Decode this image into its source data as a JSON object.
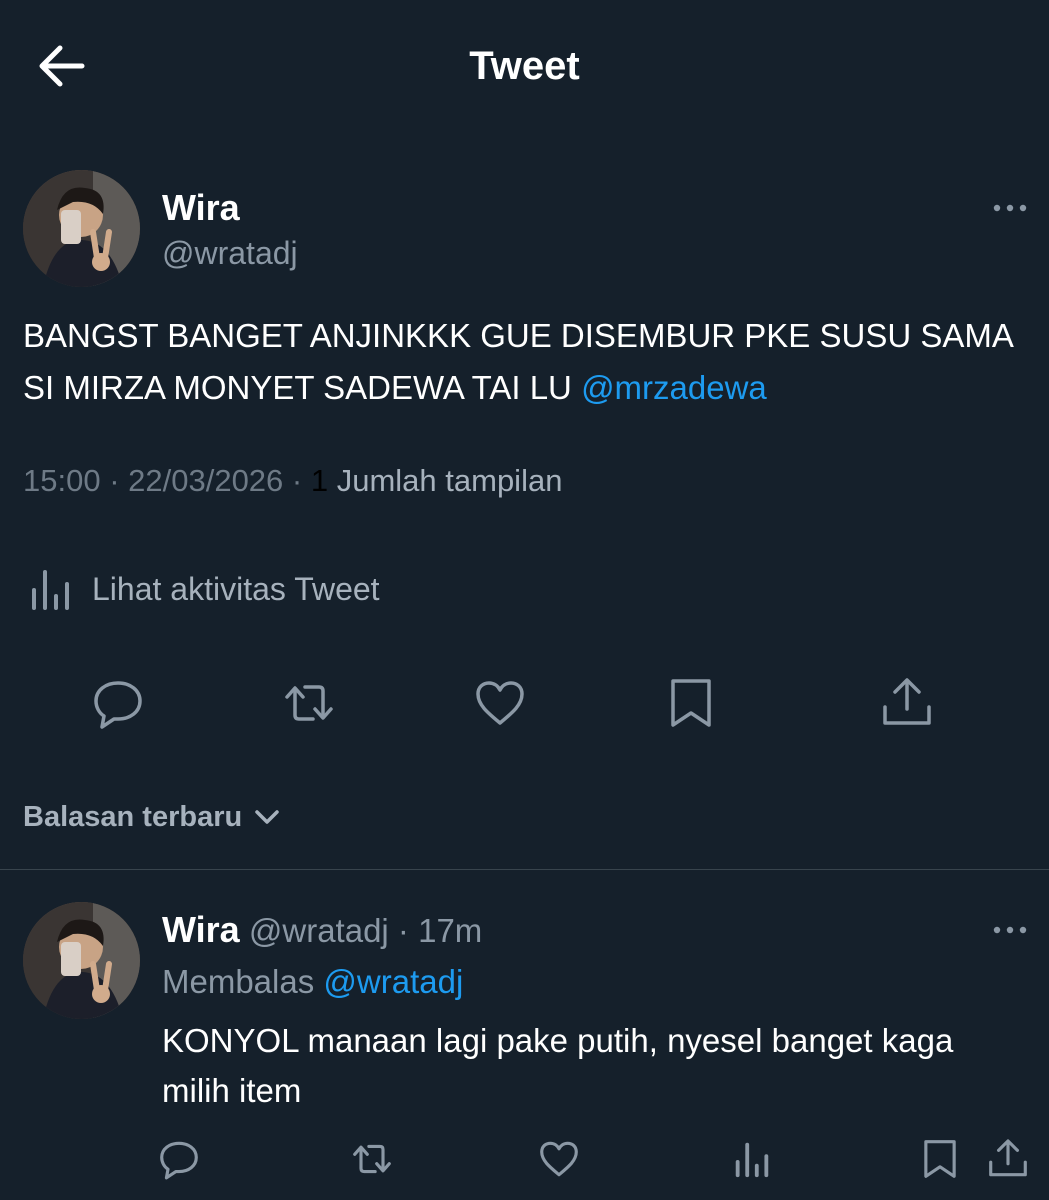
{
  "header": {
    "title": "Tweet"
  },
  "tweet": {
    "author_name": "Wira",
    "author_handle": "@wratadj",
    "text": "BANGST BANGET ANJINKKK GUE DISEMBUR PKE SUSU SAMA SI MIRZA MONYET SADEWA TAI LU ",
    "mention": "@mrzadewa",
    "time": "15:00",
    "date": "22/03/2026",
    "separator": " · ",
    "views_count": "1",
    "views_label": " Jumlah tampilan",
    "activity_label": "Lihat aktivitas Tweet"
  },
  "replies_sort": {
    "label": "Balasan terbaru"
  },
  "reply": {
    "author_name": "Wira",
    "author_handle": "@wratadj",
    "separator": " · ",
    "time": "17m",
    "replying_to_label": "Membalas ",
    "replying_to_handle": "@wratadj",
    "text": "KONYOL manaan lagi pake putih, nyesel banget kaga milih item"
  },
  "colors": {
    "background": "#15202b",
    "accent": "#1d9bf0",
    "muted": "#8b98a5",
    "divider": "#38444d"
  },
  "icons": {
    "back": "arrow-left-icon",
    "more": "more-horizontal-icon",
    "activity": "bar-chart-icon",
    "reply": "comment-icon",
    "retweet": "retweet-icon",
    "like": "heart-icon",
    "bookmark": "bookmark-icon",
    "share": "share-icon",
    "views": "views-icon",
    "sort": "chevron-down-icon"
  }
}
